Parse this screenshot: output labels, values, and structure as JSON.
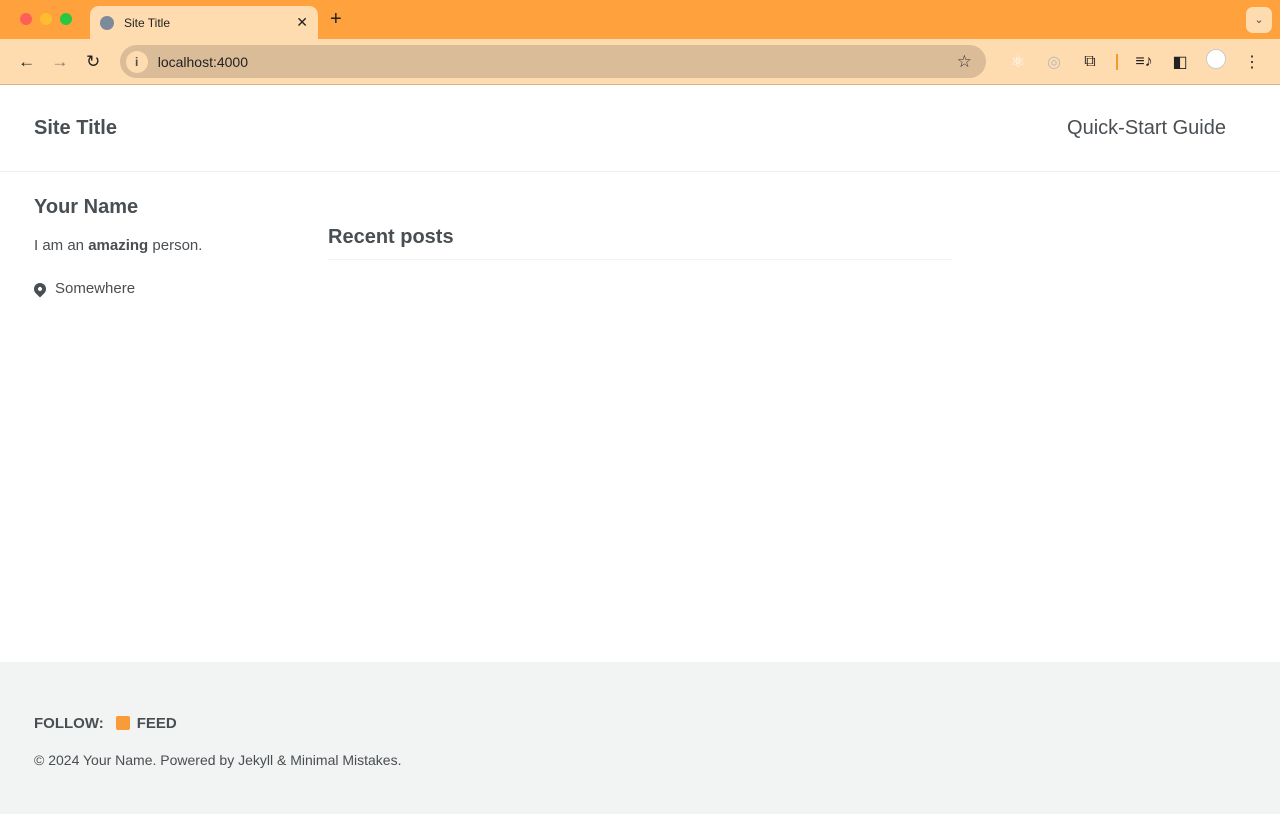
{
  "browser": {
    "tab_title": "Site Title",
    "url": "localhost:4000",
    "colors": {
      "tabbar": "#ffa23e",
      "toolbar": "#ffdbb0"
    }
  },
  "masthead": {
    "site_title": "Site Title",
    "nav_link": "Quick-Start Guide"
  },
  "sidebar": {
    "name": "Your Name",
    "bio_pre": "I am an ",
    "bio_bold": "amazing",
    "bio_post": " person.",
    "location": "Somewhere"
  },
  "main": {
    "heading": "Recent posts"
  },
  "footer": {
    "follow": "FOLLOW:",
    "feed": "FEED",
    "copyright": "© 2024 Your Name. Powered by Jekyll & Minimal Mistakes.",
    "rss_color": "#fa9b39"
  }
}
